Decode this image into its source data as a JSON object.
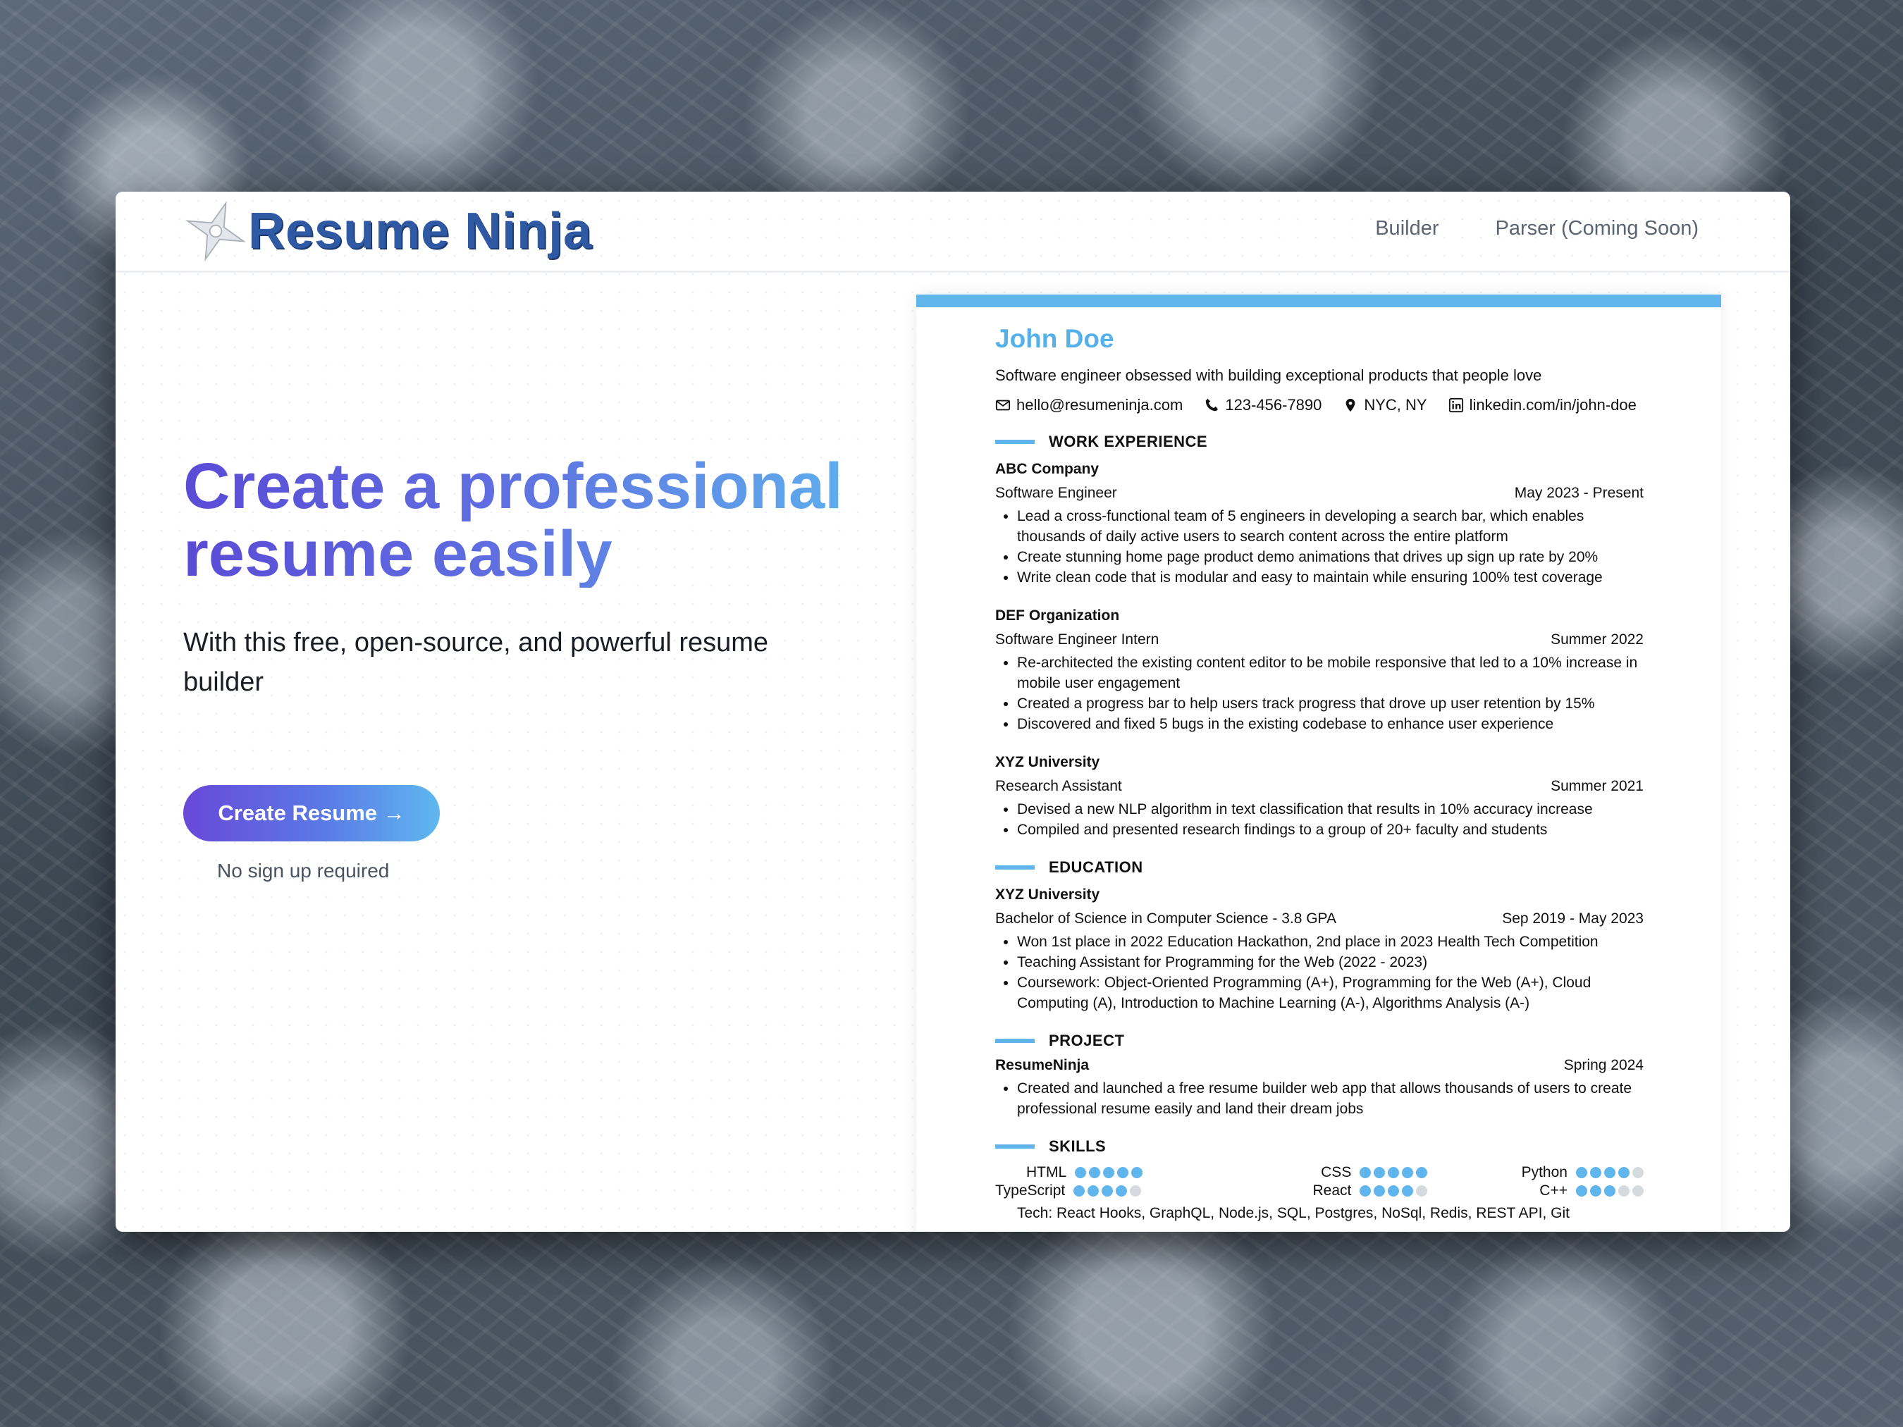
{
  "app": {
    "logo_text": "Resume Ninja"
  },
  "nav": {
    "builder": "Builder",
    "parser": "Parser (Coming Soon)"
  },
  "hero": {
    "title_line1": "Create a professional",
    "title_line2": "resume easily",
    "subtitle": "With this free, open-source, and powerful resume builder",
    "cta": "Create Resume →",
    "note": "No sign up required"
  },
  "colors": {
    "accent": "#5fb5ec",
    "brand": "#2f5aa3",
    "gradient_start": "#6848d8"
  },
  "resume": {
    "name": "John Doe",
    "summary": "Software engineer obsessed with building exceptional products that people love",
    "contacts": {
      "email": "hello@resumeninja.com",
      "phone": "123-456-7890",
      "location": "NYC, NY",
      "linkedin": "linkedin.com/in/john-doe"
    },
    "sections": {
      "work": "WORK EXPERIENCE",
      "education": "EDUCATION",
      "project": "PROJECT",
      "skills": "SKILLS"
    },
    "work": [
      {
        "company": "ABC Company",
        "title": "Software Engineer",
        "date": "May 2023 - Present",
        "bullets": [
          "Lead a cross-functional team of 5 engineers in developing a search bar, which enables thousands of daily active users to search content across the entire platform",
          "Create stunning home page product demo animations that drives up sign up rate by 20%",
          "Write clean code that is modular and easy to maintain while ensuring 100% test coverage"
        ]
      },
      {
        "company": "DEF Organization",
        "title": "Software Engineer Intern",
        "date": "Summer 2022",
        "bullets": [
          "Re-architected the existing content editor to be mobile responsive that led to a 10% increase in mobile user engagement",
          "Created a progress bar to help users track progress that drove up user retention by 15%",
          "Discovered and fixed 5 bugs in the existing codebase to enhance user experience"
        ]
      },
      {
        "company": "XYZ University",
        "title": "Research Assistant",
        "date": "Summer 2021",
        "bullets": [
          "Devised a new NLP algorithm in text classification that results in 10% accuracy increase",
          "Compiled and presented research findings to a group of 20+ faculty and students"
        ]
      }
    ],
    "education": {
      "school": "XYZ University",
      "degree": "Bachelor of Science in Computer Science - 3.8 GPA",
      "date": "Sep 2019 - May 2023",
      "bullets": [
        "Won 1st place in 2022 Education Hackathon, 2nd place in 2023 Health Tech Competition",
        "Teaching Assistant for Programming for the Web (2022 - 2023)",
        "Coursework: Object-Oriented Programming (A+), Programming for the Web (A+), Cloud Computing (A), Introduction to Machine Learning (A-), Algorithms Analysis (A-)"
      ]
    },
    "project": {
      "name": "ResumeNinja",
      "date": "Spring 2024",
      "bullets": [
        "Created and launched a free resume builder web app that allows thousands of users to create professional resume easily and land their dream jobs"
      ]
    },
    "skills": [
      {
        "name": "HTML",
        "level": 5
      },
      {
        "name": "CSS",
        "level": 5
      },
      {
        "name": "Python",
        "level": 4
      },
      {
        "name": "TypeScript",
        "level": 4
      },
      {
        "name": "React",
        "level": 4
      },
      {
        "name": "C++",
        "level": 3
      }
    ],
    "skills_max": 5,
    "tech_line": "Tech: React Hooks, GraphQL, Node.js, SQL, Postgres, NoSql, Redis, REST API, Git"
  }
}
